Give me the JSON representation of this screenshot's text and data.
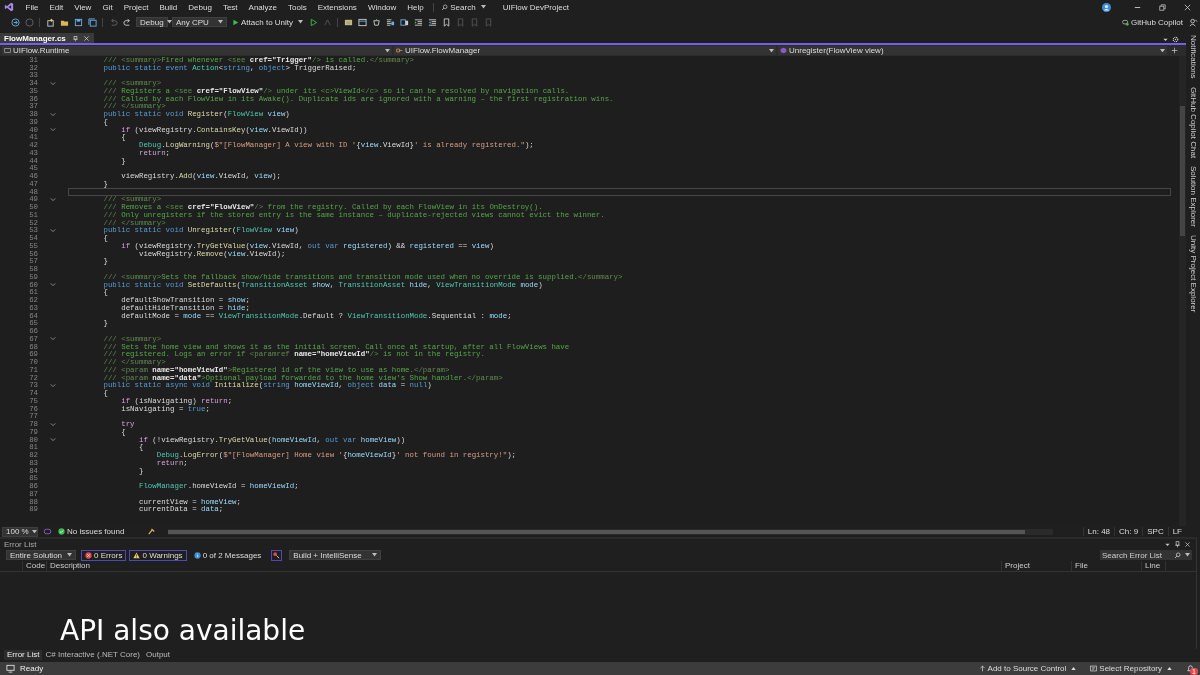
{
  "menu": {
    "items": [
      "File",
      "Edit",
      "View",
      "Git",
      "Project",
      "Build",
      "Debug",
      "Test",
      "Analyze",
      "Tools",
      "Extensions",
      "Window",
      "Help"
    ],
    "search": "Search",
    "title": "UIFlow DevProject"
  },
  "toolbar": {
    "configuration": "Debug",
    "platform": "Any CPU",
    "run_label": "Attach to Unity",
    "copilot": "GitHub Copilot"
  },
  "tabs": [
    {
      "label": "FlowManager.cs",
      "selected": true
    }
  ],
  "nav_bar": {
    "project": "UIFlow.Runtime",
    "type": "UIFlow.FlowManager",
    "member": "Unregister(FlowView view)"
  },
  "side_tabs": [
    "Notifications",
    "GitHub Copilot Chat",
    "Solution Explorer",
    "Unity Project Explorer"
  ],
  "editor": {
    "lines": [
      {
        "number": "31",
        "fold": false,
        "current": false,
        "segments": [
          {
            "kind": "x",
            "text": "        /// <summary>"
          },
          {
            "kind": "d",
            "text": "Fired whenever "
          },
          {
            "kind": "x",
            "text": "<see "
          },
          {
            "kind": "a",
            "text": "cref=\"Trigger\""
          },
          {
            "kind": "x",
            "text": "/>"
          },
          {
            "kind": "d",
            "text": " is called."
          },
          {
            "kind": "x",
            "text": "</summary>"
          }
        ]
      },
      {
        "number": "32",
        "fold": false,
        "current": false,
        "segments": [
          {
            "kind": "k",
            "text": "        public static event "
          },
          {
            "kind": "t",
            "text": "Action"
          },
          {
            "kind": "p",
            "text": "<"
          },
          {
            "kind": "k",
            "text": "string"
          },
          {
            "kind": "p",
            "text": ", "
          },
          {
            "kind": "k",
            "text": "object"
          },
          {
            "kind": "p",
            "text": "> TriggerRaised;"
          }
        ]
      },
      {
        "number": "33",
        "fold": false,
        "current": false
      },
      {
        "number": "34",
        "fold": true,
        "current": false,
        "segments": [
          {
            "kind": "x",
            "text": "        /// <summary>"
          }
        ]
      },
      {
        "number": "35",
        "fold": false,
        "current": false,
        "segments": [
          {
            "kind": "x",
            "text": "        /// "
          },
          {
            "kind": "d",
            "text": "Registers a "
          },
          {
            "kind": "x",
            "text": "<see "
          },
          {
            "kind": "a",
            "text": "cref=\"FlowView\""
          },
          {
            "kind": "x",
            "text": "/>"
          },
          {
            "kind": "d",
            "text": " under its "
          },
          {
            "kind": "x",
            "text": "<c>"
          },
          {
            "kind": "d",
            "text": "ViewId"
          },
          {
            "kind": "x",
            "text": "</c>"
          },
          {
            "kind": "d",
            "text": " so it can be resolved by navigation calls."
          }
        ]
      },
      {
        "number": "36",
        "fold": false,
        "current": false,
        "segments": [
          {
            "kind": "x",
            "text": "        /// "
          },
          {
            "kind": "d",
            "text": "Called by each FlowView in its Awake(). Duplicate ids are ignored with a warning – the first registration wins."
          }
        ]
      },
      {
        "number": "37",
        "fold": false,
        "current": false,
        "segments": [
          {
            "kind": "x",
            "text": "        /// </summary>"
          }
        ]
      },
      {
        "number": "38",
        "fold": true,
        "current": false,
        "segments": [
          {
            "kind": "k",
            "text": "        public static void "
          },
          {
            "kind": "m",
            "text": "Register"
          },
          {
            "kind": "p",
            "text": "("
          },
          {
            "kind": "t",
            "text": "FlowView"
          },
          {
            "kind": "v",
            "text": " view"
          },
          {
            "kind": "p",
            "text": ")"
          }
        ]
      },
      {
        "number": "39",
        "fold": false,
        "current": false,
        "segments": [
          {
            "kind": "p",
            "text": "        {"
          }
        ]
      },
      {
        "number": "40",
        "fold": true,
        "current": false,
        "segments": [
          {
            "kind": "c",
            "text": "            if"
          },
          {
            "kind": "p",
            "text": " (viewRegistry."
          },
          {
            "kind": "m",
            "text": "ContainsKey"
          },
          {
            "kind": "p",
            "text": "("
          },
          {
            "kind": "v",
            "text": "view"
          },
          {
            "kind": "p",
            "text": ".ViewId))"
          }
        ]
      },
      {
        "number": "41",
        "fold": false,
        "current": false,
        "segments": [
          {
            "kind": "p",
            "text": "            {"
          }
        ]
      },
      {
        "number": "42",
        "fold": false,
        "current": false,
        "segments": [
          {
            "kind": "t",
            "text": "                Debug"
          },
          {
            "kind": "p",
            "text": "."
          },
          {
            "kind": "m",
            "text": "LogWarning"
          },
          {
            "kind": "p",
            "text": "("
          },
          {
            "kind": "s",
            "text": "$\"[FlowManager] A view with ID '"
          },
          {
            "kind": "p",
            "text": "{"
          },
          {
            "kind": "v",
            "text": "view"
          },
          {
            "kind": "p",
            "text": ".ViewId}"
          },
          {
            "kind": "s",
            "text": "' is already registered.\""
          },
          {
            "kind": "p",
            "text": ");"
          }
        ]
      },
      {
        "number": "43",
        "fold": false,
        "current": false,
        "segments": [
          {
            "kind": "c",
            "text": "                return"
          },
          {
            "kind": "p",
            "text": ";"
          }
        ]
      },
      {
        "number": "44",
        "fold": false,
        "current": false,
        "segments": [
          {
            "kind": "p",
            "text": "            }"
          }
        ]
      },
      {
        "number": "45",
        "fold": false,
        "current": false
      },
      {
        "number": "46",
        "fold": false,
        "current": false,
        "segments": [
          {
            "kind": "p",
            "text": "            viewRegistry."
          },
          {
            "kind": "m",
            "text": "Add"
          },
          {
            "kind": "p",
            "text": "("
          },
          {
            "kind": "v",
            "text": "view"
          },
          {
            "kind": "p",
            "text": ".ViewId, "
          },
          {
            "kind": "v",
            "text": "view"
          },
          {
            "kind": "p",
            "text": ");"
          }
        ]
      },
      {
        "number": "47",
        "fold": false,
        "current": false,
        "segments": [
          {
            "kind": "p",
            "text": "        }"
          }
        ]
      },
      {
        "number": "48",
        "fold": false,
        "current": true
      },
      {
        "number": "49",
        "fold": true,
        "current": false,
        "segments": [
          {
            "kind": "x",
            "text": "        /// <summary>"
          }
        ]
      },
      {
        "number": "50",
        "fold": false,
        "current": false,
        "segments": [
          {
            "kind": "x",
            "text": "        /// "
          },
          {
            "kind": "d",
            "text": "Removes a "
          },
          {
            "kind": "x",
            "text": "<see "
          },
          {
            "kind": "a",
            "text": "cref=\"FlowView\""
          },
          {
            "kind": "x",
            "text": "/>"
          },
          {
            "kind": "d",
            "text": " from the registry. Called by each FlowView in its OnDestroy()."
          }
        ]
      },
      {
        "number": "51",
        "fold": false,
        "current": false,
        "segments": [
          {
            "kind": "x",
            "text": "        /// "
          },
          {
            "kind": "d",
            "text": "Only unregisters if the stored entry is the same instance – duplicate-rejected views cannot evict the winner."
          }
        ]
      },
      {
        "number": "52",
        "fold": false,
        "current": false,
        "segments": [
          {
            "kind": "x",
            "text": "        /// </summary>"
          }
        ]
      },
      {
        "number": "53",
        "fold": true,
        "current": false,
        "segments": [
          {
            "kind": "k",
            "text": "        public static void "
          },
          {
            "kind": "m",
            "text": "Unregister"
          },
          {
            "kind": "p",
            "text": "("
          },
          {
            "kind": "t",
            "text": "FlowView"
          },
          {
            "kind": "v",
            "text": " view"
          },
          {
            "kind": "p",
            "text": ")"
          }
        ]
      },
      {
        "number": "54",
        "fold": false,
        "current": false,
        "segments": [
          {
            "kind": "p",
            "text": "        {"
          }
        ]
      },
      {
        "number": "55",
        "fold": false,
        "current": false,
        "segments": [
          {
            "kind": "c",
            "text": "            if"
          },
          {
            "kind": "p",
            "text": " (viewRegistry."
          },
          {
            "kind": "m",
            "text": "TryGetValue"
          },
          {
            "kind": "p",
            "text": "("
          },
          {
            "kind": "v",
            "text": "view"
          },
          {
            "kind": "p",
            "text": ".ViewId, "
          },
          {
            "kind": "k",
            "text": "out var "
          },
          {
            "kind": "v",
            "text": "registered"
          },
          {
            "kind": "p",
            "text": ") && "
          },
          {
            "kind": "v",
            "text": "registered"
          },
          {
            "kind": "p",
            "text": " == "
          },
          {
            "kind": "v",
            "text": "view"
          },
          {
            "kind": "p",
            "text": ")"
          }
        ]
      },
      {
        "number": "56",
        "fold": false,
        "current": false,
        "segments": [
          {
            "kind": "p",
            "text": "                viewRegistry."
          },
          {
            "kind": "m",
            "text": "Remove"
          },
          {
            "kind": "p",
            "text": "("
          },
          {
            "kind": "v",
            "text": "view"
          },
          {
            "kind": "p",
            "text": ".ViewId);"
          }
        ]
      },
      {
        "number": "57",
        "fold": false,
        "current": false,
        "segments": [
          {
            "kind": "p",
            "text": "        }"
          }
        ]
      },
      {
        "number": "58",
        "fold": false,
        "current": false
      },
      {
        "number": "59",
        "fold": false,
        "current": false,
        "segments": [
          {
            "kind": "x",
            "text": "        /// <summary>"
          },
          {
            "kind": "d",
            "text": "Sets the fallback show/hide transitions and transition mode used when no override is supplied."
          },
          {
            "kind": "x",
            "text": "</summary>"
          }
        ]
      },
      {
        "number": "60",
        "fold": true,
        "current": false,
        "segments": [
          {
            "kind": "k",
            "text": "        public static void "
          },
          {
            "kind": "m",
            "text": "SetDefaults"
          },
          {
            "kind": "p",
            "text": "("
          },
          {
            "kind": "t",
            "text": "TransitionAsset"
          },
          {
            "kind": "v",
            "text": " show"
          },
          {
            "kind": "p",
            "text": ", "
          },
          {
            "kind": "t",
            "text": "TransitionAsset"
          },
          {
            "kind": "v",
            "text": " hide"
          },
          {
            "kind": "p",
            "text": ", "
          },
          {
            "kind": "t",
            "text": "ViewTransitionMode"
          },
          {
            "kind": "v",
            "text": " mode"
          },
          {
            "kind": "p",
            "text": ")"
          }
        ]
      },
      {
        "number": "61",
        "fold": false,
        "current": false,
        "segments": [
          {
            "kind": "p",
            "text": "        {"
          }
        ]
      },
      {
        "number": "62",
        "fold": false,
        "current": false,
        "segments": [
          {
            "kind": "p",
            "text": "            defaultShowTransition = "
          },
          {
            "kind": "v",
            "text": "show"
          },
          {
            "kind": "p",
            "text": ";"
          }
        ]
      },
      {
        "number": "63",
        "fold": false,
        "current": false,
        "segments": [
          {
            "kind": "p",
            "text": "            defaultHideTransition = "
          },
          {
            "kind": "v",
            "text": "hide"
          },
          {
            "kind": "p",
            "text": ";"
          }
        ]
      },
      {
        "number": "64",
        "fold": false,
        "current": false,
        "segments": [
          {
            "kind": "p",
            "text": "            defaultMode = "
          },
          {
            "kind": "v",
            "text": "mode"
          },
          {
            "kind": "p",
            "text": " == "
          },
          {
            "kind": "t",
            "text": "ViewTransitionMode"
          },
          {
            "kind": "p",
            "text": ".Default ? "
          },
          {
            "kind": "t",
            "text": "ViewTransitionMode"
          },
          {
            "kind": "p",
            "text": ".Sequential : "
          },
          {
            "kind": "v",
            "text": "mode"
          },
          {
            "kind": "p",
            "text": ";"
          }
        ]
      },
      {
        "number": "65",
        "fold": false,
        "current": false,
        "segments": [
          {
            "kind": "p",
            "text": "        }"
          }
        ]
      },
      {
        "number": "66",
        "fold": false,
        "current": false
      },
      {
        "number": "67",
        "fold": true,
        "current": false,
        "segments": [
          {
            "kind": "x",
            "text": "        /// <summary>"
          }
        ]
      },
      {
        "number": "68",
        "fold": false,
        "current": false,
        "segments": [
          {
            "kind": "x",
            "text": "        /// "
          },
          {
            "kind": "d",
            "text": "Sets the home view and shows it as the initial screen. Call once at startup, after all FlowViews have"
          }
        ]
      },
      {
        "number": "69",
        "fold": false,
        "current": false,
        "segments": [
          {
            "kind": "x",
            "text": "        /// "
          },
          {
            "kind": "d",
            "text": "registered. Logs an error if "
          },
          {
            "kind": "x",
            "text": "<paramref "
          },
          {
            "kind": "a",
            "text": "name=\"homeViewId\""
          },
          {
            "kind": "x",
            "text": "/>"
          },
          {
            "kind": "d",
            "text": " is not in the registry."
          }
        ]
      },
      {
        "number": "70",
        "fold": false,
        "current": false,
        "segments": [
          {
            "kind": "x",
            "text": "        /// </summary>"
          }
        ]
      },
      {
        "number": "71",
        "fold": false,
        "current": false,
        "segments": [
          {
            "kind": "x",
            "text": "        /// <param "
          },
          {
            "kind": "a",
            "text": "name=\"homeViewId\""
          },
          {
            "kind": "x",
            "text": ">"
          },
          {
            "kind": "d",
            "text": "Registered id of the view to use as home."
          },
          {
            "kind": "x",
            "text": "</param>"
          }
        ]
      },
      {
        "number": "72",
        "fold": false,
        "current": false,
        "segments": [
          {
            "kind": "x",
            "text": "        /// <param "
          },
          {
            "kind": "a",
            "text": "name=\"data\""
          },
          {
            "kind": "x",
            "text": ">"
          },
          {
            "kind": "d",
            "text": "Optional payload forwarded to the home view's Show handler."
          },
          {
            "kind": "x",
            "text": "</param>"
          }
        ]
      },
      {
        "number": "73",
        "fold": true,
        "current": false,
        "segments": [
          {
            "kind": "k",
            "text": "        public static async void "
          },
          {
            "kind": "m",
            "text": "Initialize"
          },
          {
            "kind": "p",
            "text": "("
          },
          {
            "kind": "k",
            "text": "string"
          },
          {
            "kind": "v",
            "text": " homeViewId"
          },
          {
            "kind": "p",
            "text": ", "
          },
          {
            "kind": "k",
            "text": "object"
          },
          {
            "kind": "v",
            "text": " data"
          },
          {
            "kind": "p",
            "text": " = "
          },
          {
            "kind": "k",
            "text": "null"
          },
          {
            "kind": "p",
            "text": ")"
          }
        ]
      },
      {
        "number": "74",
        "fold": false,
        "current": false,
        "segments": [
          {
            "kind": "p",
            "text": "        {"
          }
        ]
      },
      {
        "number": "75",
        "fold": false,
        "current": false,
        "segments": [
          {
            "kind": "c",
            "text": "            if"
          },
          {
            "kind": "p",
            "text": " (isNavigating) "
          },
          {
            "kind": "c",
            "text": "return"
          },
          {
            "kind": "p",
            "text": ";"
          }
        ]
      },
      {
        "number": "76",
        "fold": false,
        "current": false,
        "segments": [
          {
            "kind": "p",
            "text": "            isNavigating = "
          },
          {
            "kind": "k",
            "text": "true"
          },
          {
            "kind": "p",
            "text": ";"
          }
        ]
      },
      {
        "number": "77",
        "fold": false,
        "current": false
      },
      {
        "number": "78",
        "fold": true,
        "current": false,
        "segments": [
          {
            "kind": "c",
            "text": "            try"
          }
        ]
      },
      {
        "number": "79",
        "fold": false,
        "current": false,
        "segments": [
          {
            "kind": "p",
            "text": "            {"
          }
        ]
      },
      {
        "number": "80",
        "fold": true,
        "current": false,
        "segments": [
          {
            "kind": "c",
            "text": "                if"
          },
          {
            "kind": "p",
            "text": " (!viewRegistry."
          },
          {
            "kind": "m",
            "text": "TryGetValue"
          },
          {
            "kind": "p",
            "text": "("
          },
          {
            "kind": "v",
            "text": "homeViewId"
          },
          {
            "kind": "p",
            "text": ", "
          },
          {
            "kind": "k",
            "text": "out var "
          },
          {
            "kind": "v",
            "text": "homeView"
          },
          {
            "kind": "p",
            "text": "))"
          }
        ]
      },
      {
        "number": "81",
        "fold": false,
        "current": false,
        "segments": [
          {
            "kind": "p",
            "text": "                {"
          }
        ]
      },
      {
        "number": "82",
        "fold": false,
        "current": false,
        "segments": [
          {
            "kind": "t",
            "text": "                    Debug"
          },
          {
            "kind": "p",
            "text": "."
          },
          {
            "kind": "m",
            "text": "LogError"
          },
          {
            "kind": "p",
            "text": "("
          },
          {
            "kind": "s",
            "text": "$\"[FlowManager] Home view '"
          },
          {
            "kind": "p",
            "text": "{"
          },
          {
            "kind": "v",
            "text": "homeViewId"
          },
          {
            "kind": "p",
            "text": "}"
          },
          {
            "kind": "s",
            "text": "' not found in registry!\""
          },
          {
            "kind": "p",
            "text": ");"
          }
        ]
      },
      {
        "number": "83",
        "fold": false,
        "current": false,
        "segments": [
          {
            "kind": "c",
            "text": "                    return"
          },
          {
            "kind": "p",
            "text": ";"
          }
        ]
      },
      {
        "number": "84",
        "fold": false,
        "current": false,
        "segments": [
          {
            "kind": "p",
            "text": "                }"
          }
        ]
      },
      {
        "number": "85",
        "fold": false,
        "current": false
      },
      {
        "number": "86",
        "fold": false,
        "current": false,
        "segments": [
          {
            "kind": "t",
            "text": "                FlowManager"
          },
          {
            "kind": "p",
            "text": ".homeViewId = "
          },
          {
            "kind": "v",
            "text": "homeViewId"
          },
          {
            "kind": "p",
            "text": ";"
          }
        ]
      },
      {
        "number": "87",
        "fold": false,
        "current": false
      },
      {
        "number": "88",
        "fold": false,
        "current": false,
        "segments": [
          {
            "kind": "p",
            "text": "                currentView = "
          },
          {
            "kind": "v",
            "text": "homeView"
          },
          {
            "kind": "p",
            "text": ";"
          }
        ]
      },
      {
        "number": "89",
        "fold": false,
        "current": false,
        "segments": [
          {
            "kind": "p",
            "text": "                currentData = "
          },
          {
            "kind": "v",
            "text": "data"
          },
          {
            "kind": "p",
            "text": ";"
          }
        ]
      }
    ]
  },
  "editor_status": {
    "zoom": "100 %",
    "issues": "No issues found",
    "line": "Ln: 48",
    "column": "Ch: 9",
    "spacing": "SPC",
    "line_ending": "LF"
  },
  "error_list": {
    "title": "Error List",
    "scope": "Entire Solution",
    "errors": "0 Errors",
    "warnings": "0 Warnings",
    "messages": "0 of 2 Messages",
    "source": "Build + IntelliSense",
    "search": {
      "placeholder": "Search Error List"
    },
    "columns": [
      "Code",
      "Description",
      "Project",
      "File",
      "Line"
    ]
  },
  "caption": "API also available",
  "bottom_tabs": [
    {
      "label": "Error List",
      "selected": true
    },
    {
      "label": "C# Interactive (.NET Core)",
      "selected": false
    },
    {
      "label": "Output",
      "selected": false
    }
  ],
  "status_bar": {
    "status": "Ready",
    "source_control": "Add to Source Control",
    "repository": "Select Repository",
    "notifications": "1"
  }
}
